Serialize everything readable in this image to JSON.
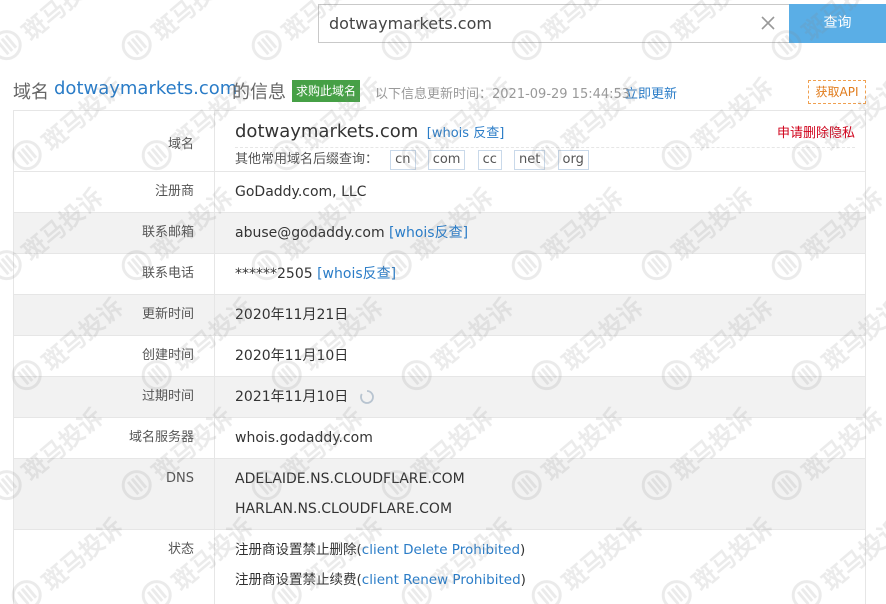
{
  "search": {
    "value": "dotwaymarkets.com",
    "button_label": "查询"
  },
  "header": {
    "prefix": "域名",
    "domain": "dotwaymarkets.com",
    "suffix": "的信息",
    "buy_label": "求购此域名",
    "update_text": "以下信息更新时间：2021-09-29 15:44:53",
    "update_link": "立即更新",
    "api_label": "获取API"
  },
  "rows": {
    "domain": {
      "label": "域名",
      "value": "dotwaymarkets.com",
      "whois_link": "[whois 反查]",
      "privacy_link": "申请删除隐私",
      "suffix_prompt": "其他常用域名后缀查询：",
      "suffixes": [
        "cn",
        "com",
        "cc",
        "net",
        "org"
      ]
    },
    "registrar": {
      "label": "注册商",
      "value": "GoDaddy.com, LLC"
    },
    "email": {
      "label": "联系邮箱",
      "value": "abuse@godaddy.com",
      "whois_link": "[whois反查]"
    },
    "phone": {
      "label": "联系电话",
      "value": "******2505",
      "whois_link": "[whois反查]"
    },
    "updated": {
      "label": "更新时间",
      "value": "2020年11月21日"
    },
    "created": {
      "label": "创建时间",
      "value": "2020年11月10日"
    },
    "expires": {
      "label": "过期时间",
      "value": "2021年11月10日"
    },
    "whois_server": {
      "label": "域名服务器",
      "value": "whois.godaddy.com"
    },
    "dns": {
      "label": "DNS",
      "values": [
        "ADELAIDE.NS.CLOUDFLARE.COM",
        "HARLAN.NS.CLOUDFLARE.COM"
      ]
    },
    "status": {
      "label": "状态",
      "items": [
        {
          "cn": "注册商设置禁止删除",
          "en": "client Delete Prohibited"
        },
        {
          "cn": "注册商设置禁止续费",
          "en": "client Renew Prohibited"
        }
      ]
    }
  },
  "watermark": {
    "text": "斑马投诉"
  },
  "colors": {
    "accent": "#2a7cc7",
    "search_button": "#5aaee6",
    "buy_badge": "#46a046",
    "privacy": "#d0021b",
    "api_border": "#f0a050"
  }
}
